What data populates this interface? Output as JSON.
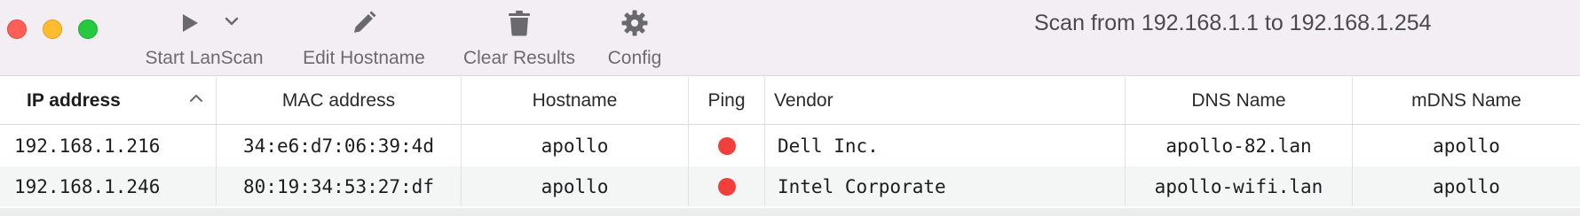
{
  "window": {
    "title": "Scan from 192.168.1.1 to 192.168.1.254"
  },
  "toolbar": {
    "start_label": "Start LanScan",
    "edit_label": "Edit Hostname",
    "clear_label": "Clear Results",
    "config_label": "Config",
    "icons": {
      "start": "play-icon",
      "start_menu": "chevron-down-icon",
      "edit": "pencil-icon",
      "clear": "trash-icon",
      "config": "gear-icon"
    }
  },
  "table": {
    "columns": [
      "IP address",
      "MAC address",
      "Hostname",
      "Ping",
      "Vendor",
      "DNS Name",
      "mDNS Name"
    ],
    "sorted_column": "IP address",
    "sort_direction": "ascending",
    "rows": [
      {
        "ip": "192.168.1.216",
        "mac": "34:e6:d7:06:39:4d",
        "hostname": "apollo",
        "ping": "red",
        "vendor": "Dell Inc.",
        "dns": "apollo-82.lan",
        "mdns": "apollo"
      },
      {
        "ip": "192.168.1.246",
        "mac": "80:19:34:53:27:df",
        "hostname": "apollo",
        "ping": "red",
        "vendor": "Intel Corporate",
        "dns": "apollo-wifi.lan",
        "mdns": "apollo"
      }
    ]
  },
  "colors": {
    "toolbar_bg": "#f3eef4",
    "ping_status": "#f1403c",
    "alt_row": "#f4f5f5"
  }
}
